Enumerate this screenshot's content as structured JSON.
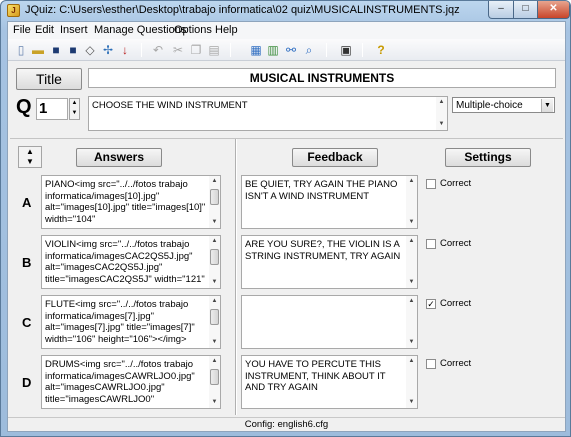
{
  "window": {
    "title": "JQuiz: C:\\Users\\esther\\Desktop\\trabajo informatica\\02 quiz\\MUSICALINSTRUMENTS.jqz",
    "app_icon": "jquiz-icon",
    "buttons": {
      "minimize": "–",
      "maximize": "□",
      "close": "✕"
    }
  },
  "menu": [
    "File",
    "Edit",
    "Insert",
    "Manage Questions",
    "Options",
    "Help"
  ],
  "toolbar": {
    "icons": [
      "new-file-icon",
      "open-folder-icon",
      "save-icon",
      "save-as-icon",
      "eraser-icon",
      "web-export-icon",
      "arrow-down-icon",
      "undo-icon",
      "cut-icon",
      "copy-icon",
      "paste-icon",
      "config-icon",
      "image-icon",
      "link-icon",
      "search-icon",
      "monitor-icon",
      "help-icon"
    ],
    "glyphs": {
      "new": "▯",
      "open": "▬",
      "save": "■",
      "save_as": "■",
      "eraser": "◇",
      "web": "✢",
      "arrow_down": "↓",
      "undo": "↶",
      "cut": "✂",
      "copy": "❐",
      "paste": "▤",
      "config": "▦",
      "image": "▥",
      "link": "⚯",
      "search": "⌕",
      "monitor": "▣",
      "help": "?"
    }
  },
  "title_button": "Title",
  "quiz_title": "MUSICAL INSTRUMENTS",
  "question": {
    "letter": "Q",
    "number": "1",
    "text": "CHOOSE THE WIND INSTRUMENT",
    "type": "Multiple-choice"
  },
  "headers": {
    "answers": "Answers",
    "feedback": "Feedback",
    "settings": "Settings"
  },
  "answers": [
    {
      "letter": "A",
      "text": "PIANO<img src=\"../../fotos trabajo informatica/images[10].jpg\" alt=\"images[10].jpg\" title=\"images[10]\" width=\"104\"",
      "feedback": "BE QUIET, TRY AGAIN THE PIANO ISN'T A WIND INSTRUMENT",
      "correct": false
    },
    {
      "letter": "B",
      "text": "VIOLIN<img src=\"../../fotos trabajo informatica/imagesCAC2QS5J.jpg\" alt=\"imagesCAC2QS5J.jpg\" title=\"imagesCAC2QS5J\" width=\"121\"",
      "feedback": "ARE YOU SURE?, THE VIOLIN IS A STRING INSTRUMENT, TRY AGAIN",
      "correct": false
    },
    {
      "letter": "C",
      "text": "FLUTE<img src=\"../../fotos trabajo informatica/images[7].jpg\" alt=\"images[7].jpg\" title=\"images[7]\" width=\"106\" height=\"106\"></img>",
      "feedback": "",
      "correct": true
    },
    {
      "letter": "D",
      "text": "DRUMS<img src=\"../../fotos trabajo informatica/imagesCAWRLJO0.jpg\" alt=\"imagesCAWRLJO0.jpg\" title=\"imagesCAWRLJO0\"",
      "feedback": "YOU HAVE TO PERCUTE THIS INSTRUMENT, THINK ABOUT IT AND TRY AGAIN",
      "correct": false
    }
  ],
  "correct_label": "Correct",
  "check_mark": "✓",
  "status": "Config: english6.cfg"
}
